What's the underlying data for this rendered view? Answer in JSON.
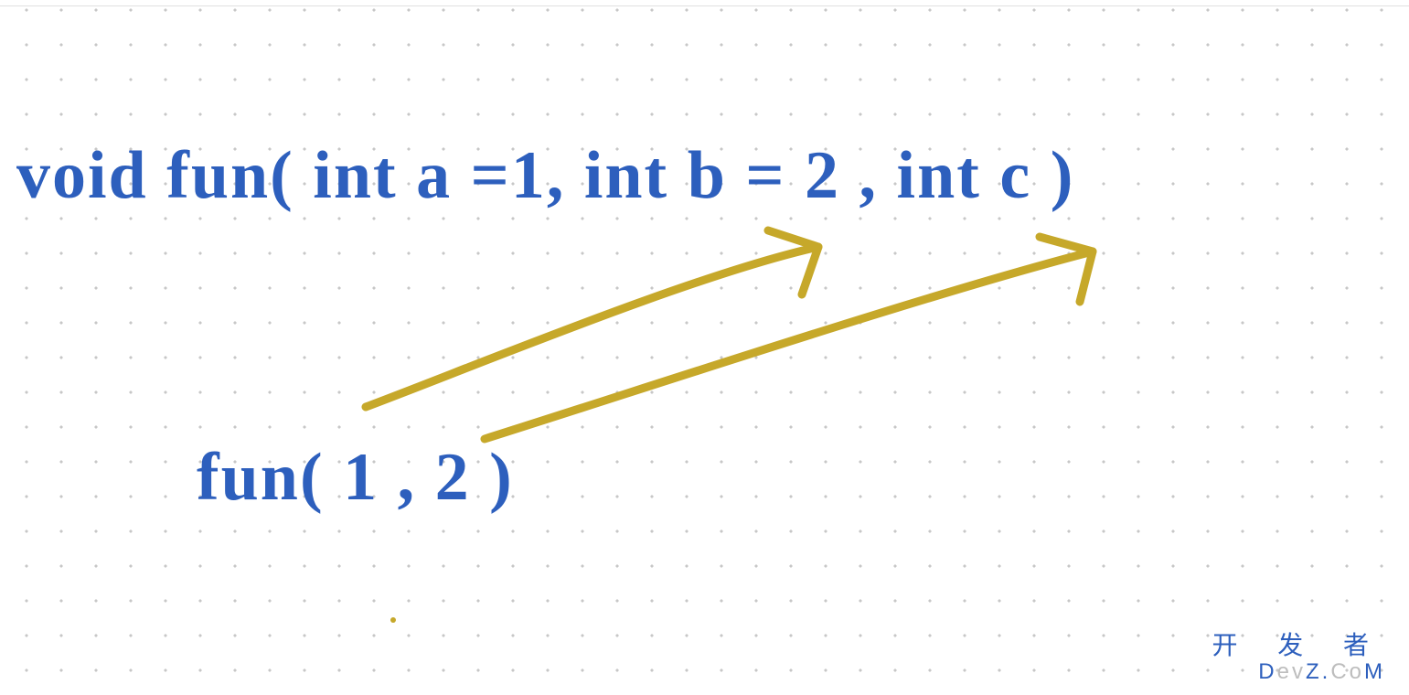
{
  "diagram": {
    "declaration": "void  fun( int  a =1, int  b = 2 ,  int  c )",
    "call": "fun(  1 , 2 )",
    "arrows": [
      {
        "from": "argument 1",
        "to": "parameter b"
      },
      {
        "from": "argument 2",
        "to": "parameter c"
      }
    ]
  },
  "colors": {
    "ink_blue": "#2d5fbd",
    "arrow_olive": "#c6a82a",
    "dot_gray": "#c7c7c7"
  },
  "watermark": {
    "line1": "开 发 者",
    "line2_prefix": "D",
    "line2_mid": "ev",
    "line2_z": "Z.",
    "line2_co": "Co",
    "line2_m": "M"
  }
}
